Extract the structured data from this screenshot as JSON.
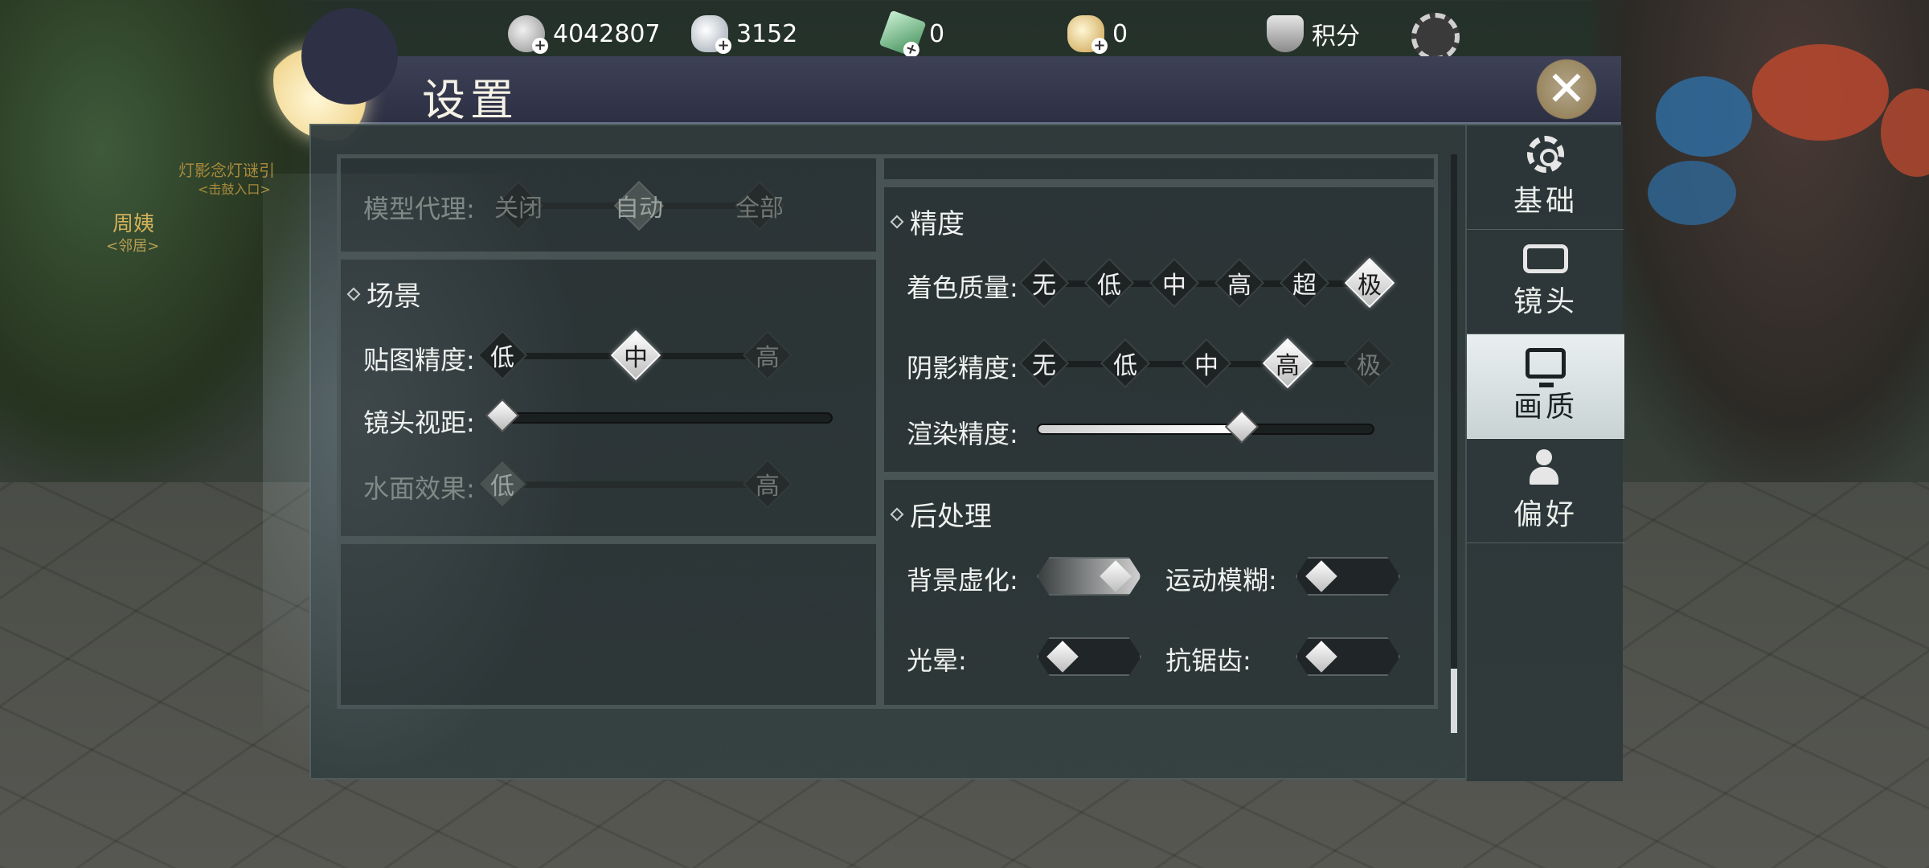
{
  "hud": {
    "currencies": [
      {
        "icon": "coin-icon",
        "value": "4042807"
      },
      {
        "icon": "silver-ingot-icon",
        "value": "3152"
      },
      {
        "icon": "jade-icon",
        "value": "0"
      },
      {
        "icon": "gold-ingot-icon",
        "value": "0"
      }
    ],
    "points_label": "积分"
  },
  "scene": {
    "npc_name": "周姨",
    "npc_title": "<邻居>",
    "hint_line1": "灯影念灯谜引",
    "hint_line2": "<击鼓入口>"
  },
  "dialog": {
    "title": "设置",
    "sections": {
      "model_proxy": {
        "label": "模型代理:",
        "options": [
          "关闭",
          "自动",
          "全部"
        ],
        "selected": "自动",
        "disabled": true
      },
      "scene": {
        "title": "场景",
        "texture": {
          "label": "贴图精度:",
          "options": [
            "低",
            "中",
            "高"
          ],
          "selected": "中",
          "disabled_options": [
            "高"
          ]
        },
        "camera_distance": {
          "label": "镜头视距:",
          "value": 0.0
        },
        "water": {
          "label": "水面效果:",
          "options": [
            "低",
            "高"
          ],
          "selected": "低",
          "disabled": true
        }
      },
      "precision": {
        "title": "精度",
        "shading": {
          "label": "着色质量:",
          "options": [
            "无",
            "低",
            "中",
            "高",
            "超",
            "极"
          ],
          "selected": "极"
        },
        "shadow": {
          "label": "阴影精度:",
          "options": [
            "无",
            "低",
            "中",
            "高",
            "极"
          ],
          "selected": "高",
          "disabled_options": [
            "极"
          ]
        },
        "render": {
          "label": "渲染精度:",
          "value": 0.6
        }
      },
      "post": {
        "title": "后处理",
        "background_blur": {
          "label": "背景虚化:",
          "on": true
        },
        "motion_blur": {
          "label": "运动模糊:",
          "on": false
        },
        "bloom": {
          "label": "光晕:",
          "on": false
        },
        "antialias": {
          "label": "抗锯齿:",
          "on": false
        }
      }
    },
    "nav": [
      {
        "label": "基础",
        "icon": "gear-icon",
        "active": false
      },
      {
        "label": "镜头",
        "icon": "camera-icon",
        "active": false
      },
      {
        "label": "画质",
        "icon": "monitor-icon",
        "active": true
      },
      {
        "label": "偏好",
        "icon": "user-settings-icon",
        "active": false
      }
    ]
  },
  "colors": {
    "panel": "#303a3c",
    "title_bar": "#3d4157",
    "selected": "#ffffff",
    "nav_active": "#e9eff0"
  }
}
